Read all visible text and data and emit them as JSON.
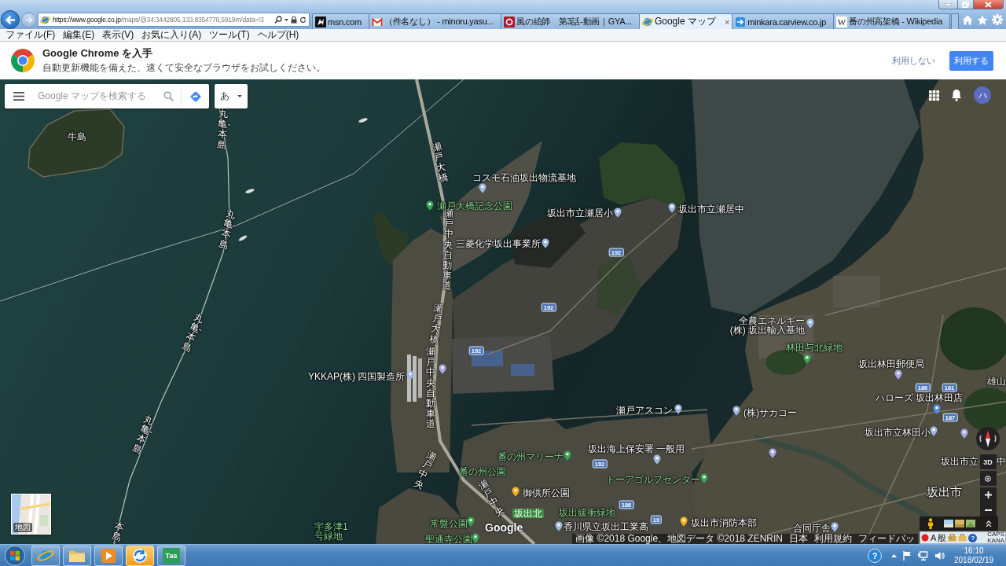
{
  "browser": {
    "address": {
      "host": "https://www.google.co.jp",
      "path": "/maps/@34.3442805,133.8354778,5919m/data=!3"
    },
    "tabs": [
      {
        "kind": "msn",
        "title": "msn.com",
        "selected": false
      },
      {
        "kind": "mail",
        "title": "（件名なし） - minoru.yasu...",
        "selected": false
      },
      {
        "kind": "video",
        "title": "風の絵師　第3話-動画｜GYA...",
        "selected": false
      },
      {
        "kind": "ie",
        "title": "Google マップ",
        "selected": true,
        "close": "×"
      },
      {
        "kind": "site",
        "title": "minkara.carview.co.jp",
        "selected": false
      },
      {
        "kind": "wiki",
        "glyph": "W",
        "title": "番の州高架橋 - Wikipedia",
        "selected": false
      }
    ],
    "menu": [
      "ファイル(F)",
      "編集(E)",
      "表示(V)",
      "お気に入り(A)",
      "ツール(T)",
      "ヘルプ(H)"
    ]
  },
  "chrome_banner": {
    "title": "Google Chrome を入手",
    "text": "自動更新機能を備えた、速くて安全なブラウザをお試しください。",
    "decline": "利用しない",
    "accept": "利用する"
  },
  "map": {
    "search": {
      "placeholder": "Google マップを検索する"
    },
    "input_tool": "あ",
    "avatar": "ハ",
    "labels": [
      {
        "text": "牛島",
        "kind": "area"
      },
      {
        "text": "コスモ石油坂出物流基地",
        "kind": "place",
        "color": "#9fb6e3"
      },
      {
        "text": "瀬戸大橋記念公園",
        "kind": "park",
        "color": "#34a853"
      },
      {
        "text": "坂出市立瀬居小",
        "kind": "place",
        "color": "#9fb6e3"
      },
      {
        "text": "坂出市立瀬居中",
        "kind": "place",
        "color": "#9fb6e3"
      },
      {
        "text": "三菱化学坂出事業所",
        "kind": "place",
        "color": "#9fb6e3"
      },
      {
        "lines": [
          "全農エネルギー",
          "(株) 坂出輸入基地"
        ],
        "kind": "place",
        "color": "#9fb6e3"
      },
      {
        "text": "林田与北緑地",
        "kind": "park",
        "color": "#34a853"
      },
      {
        "text": "坂出林田郵便局",
        "kind": "place",
        "color": "#a9a6e6"
      },
      {
        "text": "YKKAP(株) 四国製造所",
        "kind": "place",
        "color": "#9fb6e3"
      },
      {
        "text": "雄山",
        "kind": "area"
      },
      {
        "text": "ハローズ 坂出林田店",
        "kind": "place",
        "color": "#4f8fe8"
      },
      {
        "text": "瀬戸アスコン",
        "kind": "place",
        "color": "#9fb6e3"
      },
      {
        "text": "(株)サカコー",
        "kind": "place",
        "color": "#9fb6e3"
      },
      {
        "text": "坂出市立林田小",
        "kind": "place",
        "color": "#9fb6e3"
      },
      {
        "text": "番の州マリーナ",
        "kind": "park",
        "color": "#34a853"
      },
      {
        "text": "坂出海上保安署 一般用",
        "kind": "place",
        "color": "#9fb6e3"
      },
      {
        "text": "坂出市立",
        "kind": "place",
        "color": "#a9a6e6"
      },
      {
        "text": "中",
        "kind": "place"
      },
      {
        "text": "番の州公園",
        "kind": "park"
      },
      {
        "text": "トーアゴルフセンター",
        "kind": "park",
        "color": "#34a853"
      },
      {
        "text": "御供所公園",
        "kind": "place",
        "color": "#f2b01e"
      },
      {
        "text": "坂出市",
        "kind": "city"
      },
      {
        "text": "坂出北",
        "kind": "tag"
      },
      {
        "text": "坂出緩衝緑地",
        "kind": "park"
      },
      {
        "lines": [
          "宇多津1",
          "号緑地"
        ],
        "kind": "park"
      },
      {
        "text": "常盤公園",
        "kind": "park",
        "color": "#34a853"
      },
      {
        "text": "香川県立坂出工業高",
        "kind": "place",
        "color": "#9fb6e3"
      },
      {
        "text": "坂出市消防本部",
        "kind": "place",
        "color": "#f2b01e"
      },
      {
        "text": "合同庁舎",
        "kind": "place",
        "color": "#9fb6e3"
      },
      {
        "text": "聖通寺公園",
        "kind": "park",
        "color": "#34a853"
      }
    ],
    "route_labels": [
      "丸亀-本島",
      "瀬戸大橋",
      "丸亀-本島",
      "瀬戸中央自動車道",
      "丸亀-本島",
      "瀬戸大橋",
      "丸亀-本島",
      "瀬戸中央自動車道",
      "瀬戸中央",
      "瀬戸中央",
      "本島"
    ],
    "extra_pins": [
      {
        "color": "#a9a6e6"
      },
      {
        "color": "#a9a6e6"
      }
    ],
    "route_shields": [
      "192",
      "192",
      "192",
      "186",
      "161",
      "187",
      "192",
      "186",
      "19"
    ],
    "logo": "Google",
    "map_type": "地図",
    "view_3d": "3D",
    "footer": [
      "画像 ©2018 Google、地図データ ©2018 ZENRIN",
      "日本",
      "利用規約",
      "フィードバッ"
    ]
  },
  "ime_bar": {
    "mode": "A",
    "conversion": "般",
    "help": "?",
    "caps": "CAPS",
    "kana": "KANA"
  },
  "taskbar": {
    "apps": [
      {
        "kind": "ie",
        "highlighted": false
      },
      {
        "kind": "folder",
        "highlighted": false
      },
      {
        "kind": "media",
        "highlighted": false
      },
      {
        "kind": "sync",
        "highlighted": true
      },
      {
        "kind": "tile",
        "glyph": "Tas",
        "highlighted": false
      }
    ],
    "help": "?",
    "time": "16:10",
    "date": "2018/02/19"
  }
}
